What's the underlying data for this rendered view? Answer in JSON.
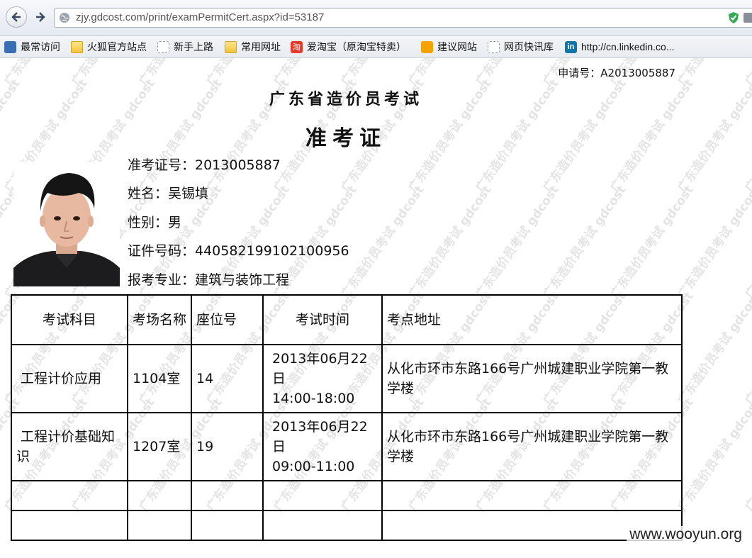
{
  "browser": {
    "url": "zjy.gdcost.com/print/examPermitCert.aspx?id=53187",
    "bookmarks": [
      {
        "label": "最常访问",
        "icon": "search-bookmark-icon"
      },
      {
        "label": "火狐官方站点",
        "icon": "folder-icon"
      },
      {
        "label": "新手上路",
        "icon": "page-icon"
      },
      {
        "label": "常用网址",
        "icon": "folder-icon"
      },
      {
        "label": "爱淘宝（原淘宝特卖）",
        "icon": "taobao-icon"
      },
      {
        "label": "建议网站",
        "icon": "bing-icon"
      },
      {
        "label": "网页快讯库",
        "icon": "page-icon"
      },
      {
        "label": "http://cn.linkedin.co...",
        "icon": "linkedin-icon"
      }
    ],
    "taobao_glyph": "淘",
    "linkedin_glyph": "in"
  },
  "cert": {
    "application_no": "申请号：A2013005887",
    "exam_title": "广东省造价员考试",
    "cert_title": "准考证",
    "permit_no": "准考证号：2013005887",
    "name": "姓名：吴锡填",
    "gender": "性别：男",
    "id_no": "证件号码：440582199102100956",
    "major": "报考专业：建筑与装饰工程"
  },
  "table": {
    "headers": [
      "考试科目",
      "考场名称",
      "座位号",
      "考试时间",
      "考点地址"
    ],
    "rows": [
      {
        "subject": "工程计价应用",
        "room": "1104室",
        "seat": "14",
        "date": "2013年06月22日",
        "time": "14:00-18:00",
        "address": "从化市环市东路166号广州城建职业学院第一教学楼"
      },
      {
        "subject": "工程计价基础知识",
        "room": "1207室",
        "seat": "19",
        "date": "2013年06月22日",
        "time": "09:00-11:00",
        "address": "从化市环市东路166号广州城建职业学院第一教学楼"
      }
    ]
  },
  "watermark_text": "广东造价员考试 gdcost",
  "site_watermark": "www.wooyun.org"
}
